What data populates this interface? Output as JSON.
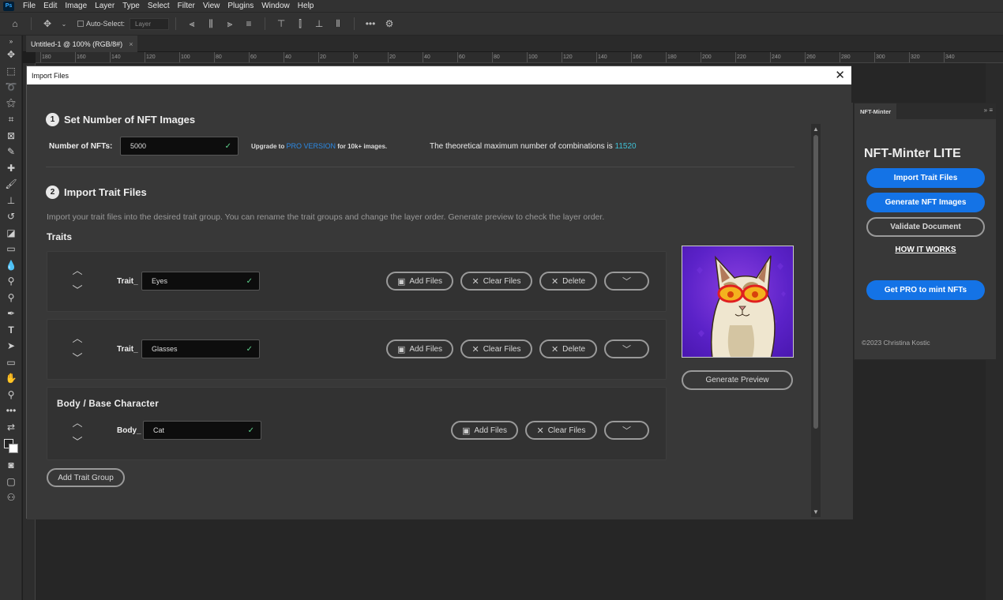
{
  "menubar": {
    "logo": "Ps",
    "items": [
      "File",
      "Edit",
      "Image",
      "Layer",
      "Type",
      "Select",
      "Filter",
      "View",
      "Plugins",
      "Window",
      "Help"
    ]
  },
  "optionsbar": {
    "auto_select_label": "Auto-Select:",
    "layer_value": "Layer"
  },
  "document_tab": {
    "title": "Untitled-1 @ 100% (RGB/8#)",
    "close": "×"
  },
  "ruler": {
    "ticks": [
      "180",
      "160",
      "140",
      "120",
      "100",
      "80",
      "60",
      "40",
      "20",
      "0",
      "20",
      "40",
      "60",
      "80",
      "100",
      "120",
      "140",
      "160",
      "180",
      "200",
      "220",
      "240",
      "260",
      "280",
      "300",
      "320",
      "340"
    ]
  },
  "dialog": {
    "title": "Import Files",
    "close": "✕",
    "section1": {
      "number": "1",
      "title": "Set Number of NFT Images",
      "nft_label": "Number of NFTs:",
      "nft_value": "5000",
      "upgrade_prefix": "Upgrade to ",
      "pro_link": "PRO VERSION",
      "upgrade_suffix": " for 10k+ images.",
      "combo_prefix": "The theoretical maximum number of combinations is ",
      "combo_value": "11520"
    },
    "section2": {
      "number": "2",
      "title": "Import Trait Files",
      "description": "Import your trait files into the desired trait group. You can rename the trait groups and change the layer order. Generate preview to check the layer order.",
      "traits_title": "Traits"
    },
    "traits": [
      {
        "prefix": "Trait_",
        "value": "Eyes",
        "add": "Add Files",
        "clear": "Clear Files",
        "delete": "Delete"
      },
      {
        "prefix": "Trait_",
        "value": "Glasses",
        "add": "Add Files",
        "clear": "Clear Files",
        "delete": "Delete"
      }
    ],
    "body": {
      "title": "Body / Base Character",
      "prefix": "Body_",
      "value": "Cat",
      "add": "Add Files",
      "clear": "Clear Files"
    },
    "add_group_label": "Add Trait Group",
    "generate_preview_label": "Generate Preview",
    "check_mark": "✓"
  },
  "panel": {
    "tab": "NFT-Minter",
    "title": "NFT-Minter LITE",
    "import_btn": "Import Trait Files",
    "generate_btn": "Generate NFT Images",
    "validate_btn": "Validate Document",
    "how_link": "HOW IT WORKS",
    "pro_btn": "Get PRO to mint NFTs",
    "copyright": "©2023 Christina Kostic"
  },
  "colors": {
    "accent_blue": "#1473e6",
    "combo_teal": "#3fc1d6",
    "check_green": "#5fd38d"
  }
}
